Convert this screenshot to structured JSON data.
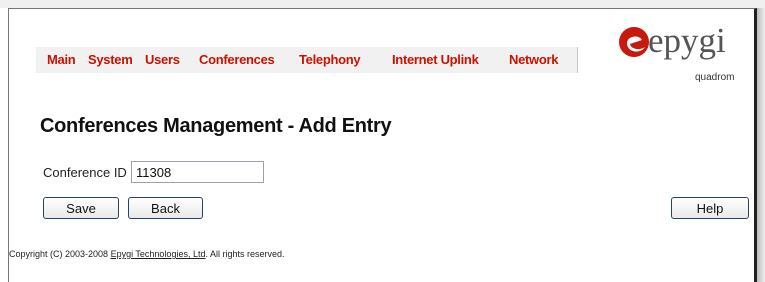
{
  "nav": {
    "items": [
      {
        "label": "Main"
      },
      {
        "label": "System"
      },
      {
        "label": "Users"
      },
      {
        "label": "Conferences"
      },
      {
        "label": "Telephony"
      },
      {
        "label": "Internet Uplink"
      },
      {
        "label": "Network"
      }
    ],
    "color": "#cc1100"
  },
  "logo": {
    "brand": "epygi",
    "product": "quadrom",
    "mark_color": "#c8190f"
  },
  "page": {
    "title": "Conferences Management - Add Entry"
  },
  "form": {
    "conference_id_label": "Conference ID",
    "conference_id_value": "11308"
  },
  "buttons": {
    "save": "Save",
    "back": "Back",
    "help": "Help"
  },
  "footer": {
    "prefix": "Copyright (C) 2003-2008 ",
    "link": "Epygi Technologies, Ltd",
    "suffix": ". All rights reserved."
  }
}
